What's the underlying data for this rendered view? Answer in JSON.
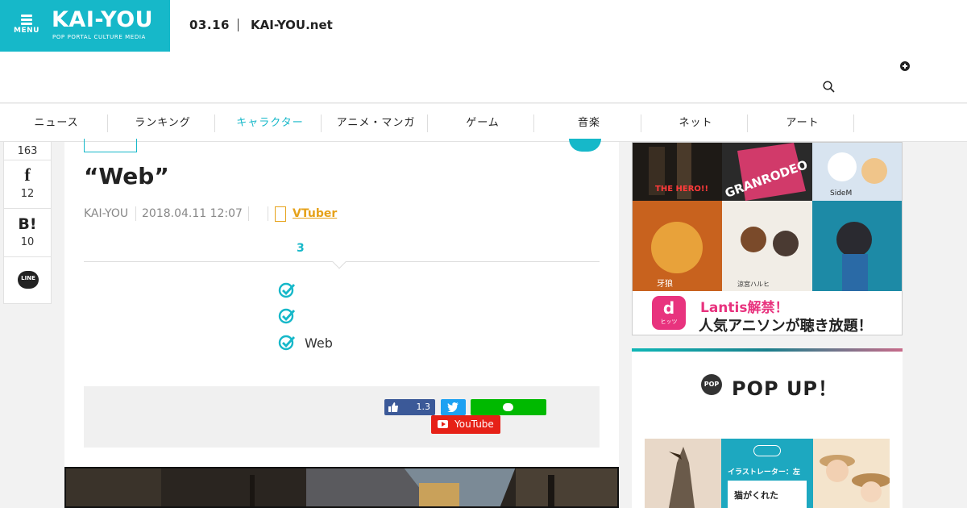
{
  "header": {
    "menu_label": "MENU",
    "logo_title": "KAI-YOU",
    "logo_subtitle": "POP PORTAL CULTURE MEDIA",
    "date": "03.16",
    "site_link": "KAI-YOU.net",
    "brand_color": "#16b8c9"
  },
  "nav": {
    "items": [
      {
        "label": "ニュース"
      },
      {
        "label": "ランキング"
      },
      {
        "label": "キャラクター"
      },
      {
        "label": "アニメ・マンガ"
      },
      {
        "label": "ゲーム"
      },
      {
        "label": "音楽"
      },
      {
        "label": "ネット"
      },
      {
        "label": "アート"
      }
    ],
    "active_index": 2,
    "active_color": "#16b8c9"
  },
  "rail": {
    "top_count": "163",
    "facebook_icon_text": "f",
    "facebook_count": "12",
    "hatena_icon_text": "B!",
    "hatena_count": "10",
    "line_icon_text": "LINE"
  },
  "article": {
    "title": "“Web”",
    "author": "KAI-YOU",
    "datetime": "2018.04.11 12:07",
    "tag": "VTuber",
    "toc_number": "3",
    "checklist": [
      "",
      "",
      "Web"
    ],
    "like_count": "1.3",
    "youtube_label": "YouTube"
  },
  "ad": {
    "banner_line1": "Lantis解禁！",
    "banner_line2": "人気アニソンが聴き放題！",
    "app_label": "ヒッツ",
    "tile_texts": [
      "THE HERO!!",
      "GRANRODEO",
      "SideM",
      "牙狼",
      "涼宮ハルヒ",
      ""
    ]
  },
  "popup": {
    "badge": "POP",
    "title": "POP UP！",
    "thumb_texts": [
      "",
      "イラストレーター：左",
      "猫がくれた"
    ]
  }
}
